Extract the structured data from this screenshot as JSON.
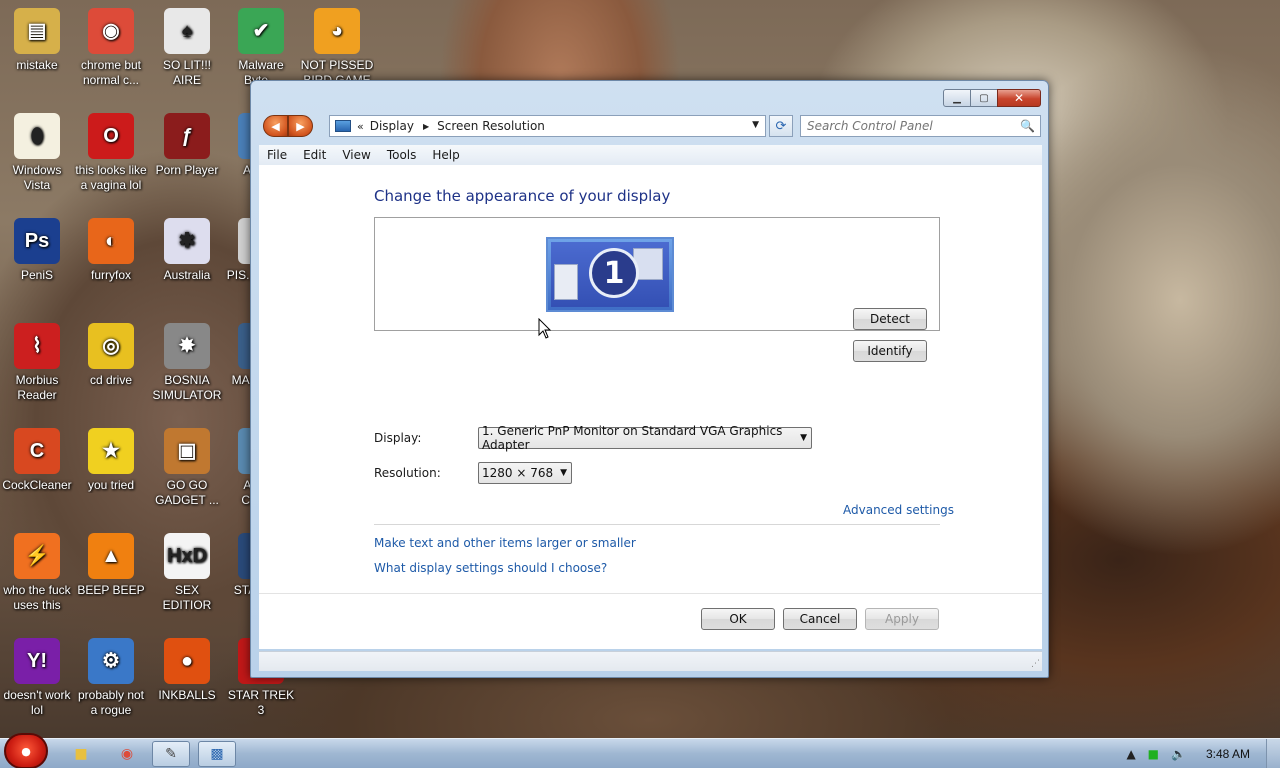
{
  "desktop": {
    "icons": [
      {
        "label": "mistake",
        "icon": "folder-tools-icon",
        "color": "#d6b04a"
      },
      {
        "label": "chrome but normal c...",
        "icon": "chrome-icon",
        "color": "#dd4b39"
      },
      {
        "label": "SO LIT!!! AIRE",
        "icon": "cards-icon",
        "color": "#e8e8e8"
      },
      {
        "label": "Malware Byte...",
        "icon": "shield-check-icon",
        "color": "#3aa655"
      },
      {
        "label": "NOT PISSED BIRD GAME",
        "icon": "pig-game-icon",
        "color": "#f0a020"
      },
      {
        "label": "Windows Vista",
        "icon": "egg-icon",
        "color": "#f4f0e0"
      },
      {
        "label": "this looks like a vagina lol",
        "icon": "opera-icon",
        "color": "#cc1b1b"
      },
      {
        "label": "Porn Player",
        "icon": "flash-icon",
        "color": "#8b1c1c"
      },
      {
        "label": "PeniS",
        "icon": "photoshop-icon",
        "color": "#1b3f8f"
      },
      {
        "label": "furryfox",
        "icon": "firefox-icon",
        "color": "#e8661a"
      },
      {
        "label": "Australia",
        "icon": "spider-icon",
        "color": "#ddddee"
      },
      {
        "label": "Morbius Reader",
        "icon": "pdf-icon",
        "color": "#cc1f1f"
      },
      {
        "label": "cd drive",
        "icon": "cd-icon",
        "color": "#e8c020"
      },
      {
        "label": "BOSNIA SIMULATOR",
        "icon": "mine-icon",
        "color": "#888888"
      },
      {
        "label": "CockCleaner",
        "icon": "ccleaner-icon",
        "color": "#d84820"
      },
      {
        "label": "you tried",
        "icon": "star-icon",
        "color": "#f0d020"
      },
      {
        "label": "GO GO GADGET ...",
        "icon": "briefcase-icon",
        "color": "#c07830"
      },
      {
        "label": "who the fuck uses this",
        "icon": "bolt-icon",
        "color": "#f07020"
      },
      {
        "label": "BEEP BEEP",
        "icon": "vlc-cone-icon",
        "color": "#f08010"
      },
      {
        "label": "SEX EDITIOR",
        "icon": "hxd-icon",
        "color": "#f4f4f4"
      },
      {
        "label": "doesn't work lol",
        "icon": "yahoo-icon",
        "color": "#7a1fa8"
      },
      {
        "label": "probably not a rogue",
        "icon": "monitor-gear-icon",
        "color": "#3a78c8"
      },
      {
        "label": "INKBALLS",
        "icon": "inkball-icon",
        "color": "#e05010"
      },
      {
        "label": "STAR TREK 3",
        "icon": "star-trek-icon",
        "color": "#c01818"
      },
      {
        "label": "ANG...",
        "icon": "app-icon",
        "color": "#4a7fb8"
      },
      {
        "label": "PIS... AVIA...",
        "icon": "app-icon",
        "color": "#d0d0d0"
      },
      {
        "label": "MA... UN...",
        "icon": "app-icon",
        "color": "#3a5f8a"
      },
      {
        "label": "AGE... CHIC...",
        "icon": "app-icon",
        "color": "#5a8ab0"
      },
      {
        "label": "STA... C...",
        "icon": "app-icon",
        "color": "#2a4a7a"
      }
    ]
  },
  "window": {
    "nav": {
      "back": "◀",
      "forward": "▶"
    },
    "address": {
      "chevrons": "«",
      "crumb1": "Display",
      "sep": "▶",
      "crumb2": "Screen Resolution"
    },
    "search_placeholder": "Search Control Panel",
    "menu": [
      "File",
      "Edit",
      "View",
      "Tools",
      "Help"
    ],
    "heading": "Change the appearance of your display",
    "monitor_number": "1",
    "detect_label": "Detect",
    "identify_label": "Identify",
    "display_label": "Display:",
    "display_value": "1. Generic PnP Monitor on Standard VGA Graphics Adapter",
    "resolution_label": "Resolution:",
    "resolution_value": "1280 × 768",
    "advanced_link": "Advanced settings",
    "link_text_size": "Make text and other items larger or smaller",
    "link_help": "What display settings should I choose?",
    "ok_label": "OK",
    "cancel_label": "Cancel",
    "apply_label": "Apply"
  },
  "taskbar": {
    "clock": "3:48 AM"
  },
  "colors": {
    "link": "#1e5aa8",
    "heading": "#1e3287",
    "close_button": "#c8442c"
  }
}
